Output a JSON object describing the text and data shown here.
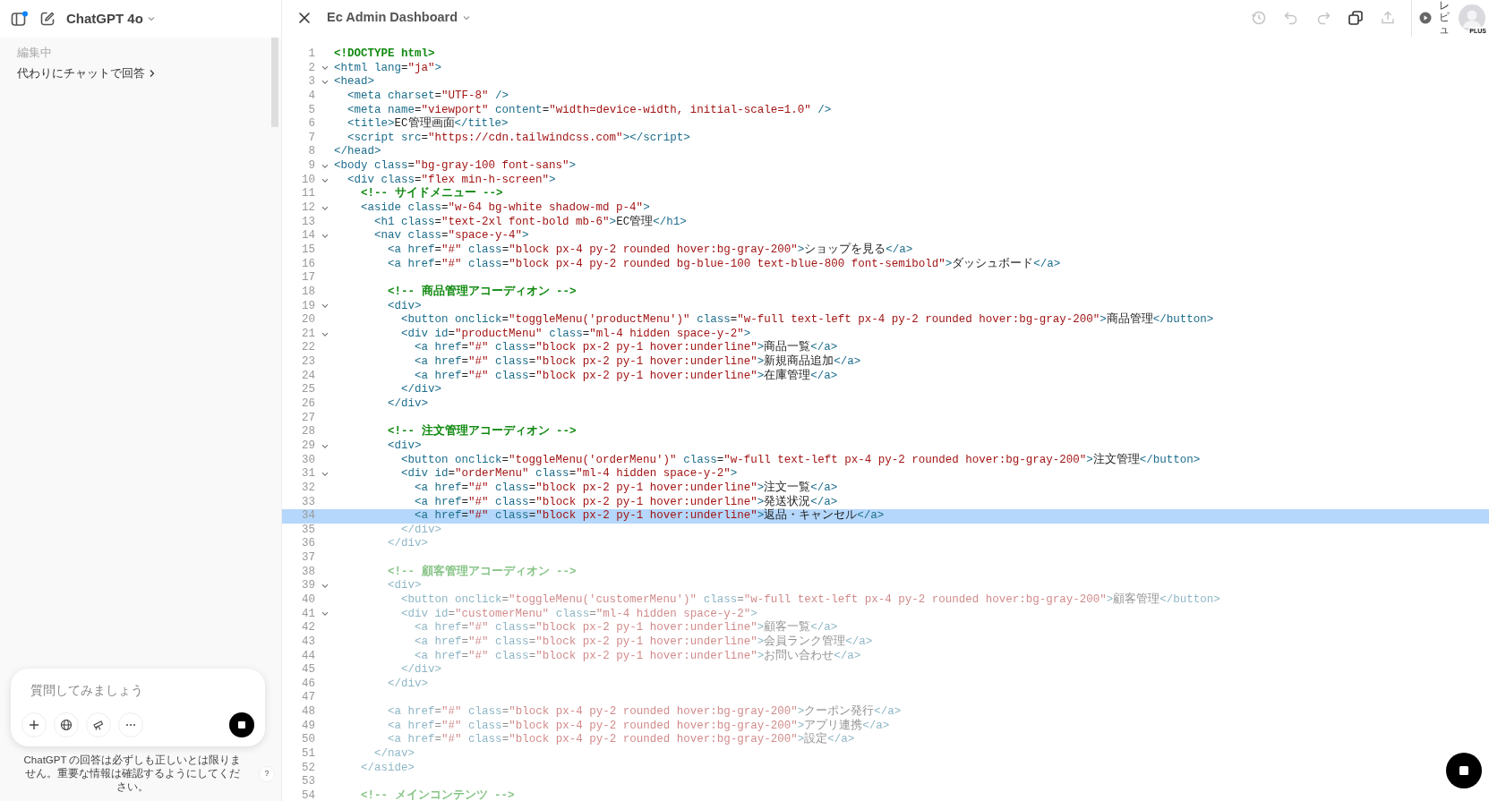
{
  "sidebar": {
    "model": "ChatGPT 4o",
    "status": "編集中",
    "link": "代わりにチャットで回答",
    "composer": {
      "placeholder": "質問してみましょう"
    },
    "disclaimer": "ChatGPT の回答は必ずしも正しいとは限りません。重要な情報は確認するようにしてください。",
    "help": "?"
  },
  "editor": {
    "title": "Ec Admin Dashboard",
    "toolbar": [
      {
        "kind": "history",
        "disabled": true
      },
      {
        "kind": "undo",
        "disabled": true
      },
      {
        "kind": "redo",
        "disabled": true
      },
      {
        "kind": "copy",
        "disabled": false
      },
      {
        "kind": "share",
        "disabled": true
      }
    ],
    "preview_label": "レビュ",
    "plan_badge": "PLUS",
    "lines": [
      {
        "n": "1",
        "text": "<!DOCTYPE html>",
        "fold": false,
        "highlighted": false,
        "faded": false
      },
      {
        "n": "2",
        "text": "<html lang=\"ja\">",
        "fold": true,
        "highlighted": false,
        "faded": false
      },
      {
        "n": "3",
        "text": "<head>",
        "fold": true,
        "highlighted": false,
        "faded": false
      },
      {
        "n": "4",
        "text": "  <meta charset=\"UTF-8\" />",
        "fold": false,
        "highlighted": false,
        "faded": false
      },
      {
        "n": "5",
        "text": "  <meta name=\"viewport\" content=\"width=device-width, initial-scale=1.0\" />",
        "fold": false,
        "highlighted": false,
        "faded": false
      },
      {
        "n": "6",
        "text": "  <title>EC管理画面</title>",
        "fold": false,
        "highlighted": false,
        "faded": false
      },
      {
        "n": "7",
        "text": "  <script src=\"https://cdn.tailwindcss.com\"></script>",
        "fold": false,
        "highlighted": false,
        "faded": false
      },
      {
        "n": "8",
        "text": "</head>",
        "fold": false,
        "highlighted": false,
        "faded": false
      },
      {
        "n": "9",
        "text": "<body class=\"bg-gray-100 font-sans\">",
        "fold": true,
        "highlighted": false,
        "faded": false
      },
      {
        "n": "10",
        "text": "  <div class=\"flex min-h-screen\">",
        "fold": true,
        "highlighted": false,
        "faded": false
      },
      {
        "n": "11",
        "text": "    <!-- サイドメニュー -->",
        "fold": false,
        "highlighted": false,
        "faded": false
      },
      {
        "n": "12",
        "text": "    <aside class=\"w-64 bg-white shadow-md p-4\">",
        "fold": true,
        "highlighted": false,
        "faded": false
      },
      {
        "n": "13",
        "text": "      <h1 class=\"text-2xl font-bold mb-6\">EC管理</h1>",
        "fold": false,
        "highlighted": false,
        "faded": false
      },
      {
        "n": "14",
        "text": "      <nav class=\"space-y-4\">",
        "fold": true,
        "highlighted": false,
        "faded": false
      },
      {
        "n": "15",
        "text": "        <a href=\"#\" class=\"block px-4 py-2 rounded hover:bg-gray-200\">ショップを見る</a>",
        "fold": false,
        "highlighted": false,
        "faded": false
      },
      {
        "n": "16",
        "text": "        <a href=\"#\" class=\"block px-4 py-2 rounded bg-blue-100 text-blue-800 font-semibold\">ダッシュボード</a>",
        "fold": false,
        "highlighted": false,
        "faded": false
      },
      {
        "n": "17",
        "fold": false,
        "highlighted": false
      },
      {
        "n": "18",
        "text": "        <!-- 商品管理アコーディオン -->",
        "fold": false,
        "highlighted": false,
        "faded": false
      },
      {
        "n": "19",
        "text": "        <div>",
        "fold": true,
        "highlighted": false,
        "faded": false
      },
      {
        "n": "20",
        "text": "          <button onclick=\"toggleMenu('productMenu')\" class=\"w-full text-left px-4 py-2 rounded hover:bg-gray-200\">商品管理</button>",
        "fold": false,
        "highlighted": false,
        "faded": false
      },
      {
        "n": "21",
        "text": "          <div id=\"productMenu\" class=\"ml-4 hidden space-y-2\">",
        "fold": true,
        "highlighted": false,
        "faded": false
      },
      {
        "n": "22",
        "text": "            <a href=\"#\" class=\"block px-2 py-1 hover:underline\">商品一覧</a>",
        "fold": false,
        "highlighted": false,
        "faded": false
      },
      {
        "n": "23",
        "text": "            <a href=\"#\" class=\"block px-2 py-1 hover:underline\">新規商品追加</a>",
        "fold": false,
        "highlighted": false,
        "faded": false
      },
      {
        "n": "24",
        "text": "            <a href=\"#\" class=\"block px-2 py-1 hover:underline\">在庫管理</a>",
        "fold": false,
        "highlighted": false,
        "faded": false
      },
      {
        "n": "25",
        "text": "          </div>",
        "fold": false,
        "highlighted": false,
        "faded": false
      },
      {
        "n": "26",
        "text": "        </div>",
        "fold": false,
        "highlighted": false,
        "faded": false
      },
      {
        "n": "27",
        "fold": false,
        "highlighted": false
      },
      {
        "n": "28",
        "text": "        <!-- 注文管理アコーディオン -->",
        "fold": false,
        "highlighted": false,
        "faded": false
      },
      {
        "n": "29",
        "text": "        <div>",
        "fold": true,
        "highlighted": false,
        "faded": false
      },
      {
        "n": "30",
        "text": "          <button onclick=\"toggleMenu('orderMenu')\" class=\"w-full text-left px-4 py-2 rounded hover:bg-gray-200\">注文管理</button>",
        "fold": false,
        "highlighted": false,
        "faded": false
      },
      {
        "n": "31",
        "text": "          <div id=\"orderMenu\" class=\"ml-4 hidden space-y-2\">",
        "fold": true,
        "highlighted": false,
        "faded": false
      },
      {
        "n": "32",
        "text": "            <a href=\"#\" class=\"block px-2 py-1 hover:underline\">注文一覧</a>",
        "fold": false,
        "highlighted": false,
        "faded": false
      },
      {
        "n": "33",
        "text": "            <a href=\"#\" class=\"block px-2 py-1 hover:underline\">発送状況</a>",
        "fold": false,
        "highlighted": false,
        "faded": false
      },
      {
        "n": "34",
        "text": "            <a href=\"#\" class=\"block px-2 py-1 hover:underline\">返品・キャンセル</a>",
        "fold": false,
        "highlighted": true,
        "faded": false
      },
      {
        "n": "35",
        "text": "          </div>",
        "fold": false,
        "highlighted": false,
        "faded": true
      },
      {
        "n": "36",
        "text": "        </div>",
        "fold": false,
        "highlighted": false,
        "faded": true
      },
      {
        "n": "37",
        "fold": false,
        "highlighted": false
      },
      {
        "n": "38",
        "text": "        <!-- 顧客管理アコーディオン -->",
        "fold": false,
        "highlighted": false,
        "faded": true
      },
      {
        "n": "39",
        "text": "        <div>",
        "fold": true,
        "highlighted": false,
        "faded": true
      },
      {
        "n": "40",
        "text": "          <button onclick=\"toggleMenu('customerMenu')\" class=\"w-full text-left px-4 py-2 rounded hover:bg-gray-200\">顧客管理</button>",
        "fold": false,
        "highlighted": false,
        "faded": true
      },
      {
        "n": "41",
        "text": "          <div id=\"customerMenu\" class=\"ml-4 hidden space-y-2\">",
        "fold": true,
        "highlighted": false,
        "faded": true
      },
      {
        "n": "42",
        "text": "            <a href=\"#\" class=\"block px-2 py-1 hover:underline\">顧客一覧</a>",
        "fold": false,
        "highlighted": false,
        "faded": true
      },
      {
        "n": "43",
        "text": "            <a href=\"#\" class=\"block px-2 py-1 hover:underline\">会員ランク管理</a>",
        "fold": false,
        "highlighted": false,
        "faded": true
      },
      {
        "n": "44",
        "text": "            <a href=\"#\" class=\"block px-2 py-1 hover:underline\">お問い合わせ</a>",
        "fold": false,
        "highlighted": false,
        "faded": true
      },
      {
        "n": "45",
        "text": "          </div>",
        "fold": false,
        "highlighted": false,
        "faded": true
      },
      {
        "n": "46",
        "text": "        </div>",
        "fold": false,
        "highlighted": false,
        "faded": true
      },
      {
        "n": "47",
        "fold": false,
        "highlighted": false
      },
      {
        "n": "48",
        "text": "        <a href=\"#\" class=\"block px-4 py-2 rounded hover:bg-gray-200\">クーポン発行</a>",
        "fold": false,
        "highlighted": false,
        "faded": true
      },
      {
        "n": "49",
        "text": "        <a href=\"#\" class=\"block px-4 py-2 rounded hover:bg-gray-200\">アプリ連携</a>",
        "fold": false,
        "highlighted": false,
        "faded": true
      },
      {
        "n": "50",
        "text": "        <a href=\"#\" class=\"block px-4 py-2 rounded hover:bg-gray-200\">設定</a>",
        "fold": false,
        "highlighted": false,
        "faded": true
      },
      {
        "n": "51",
        "text": "      </nav>",
        "fold": false,
        "highlighted": false,
        "faded": true
      },
      {
        "n": "52",
        "text": "    </aside>",
        "fold": false,
        "highlighted": false,
        "faded": true
      },
      {
        "n": "53",
        "fold": false,
        "highlighted": false
      },
      {
        "n": "54",
        "text": "    <!-- メインコンテンツ -->",
        "fold": false,
        "highlighted": false,
        "faded": true
      }
    ]
  }
}
